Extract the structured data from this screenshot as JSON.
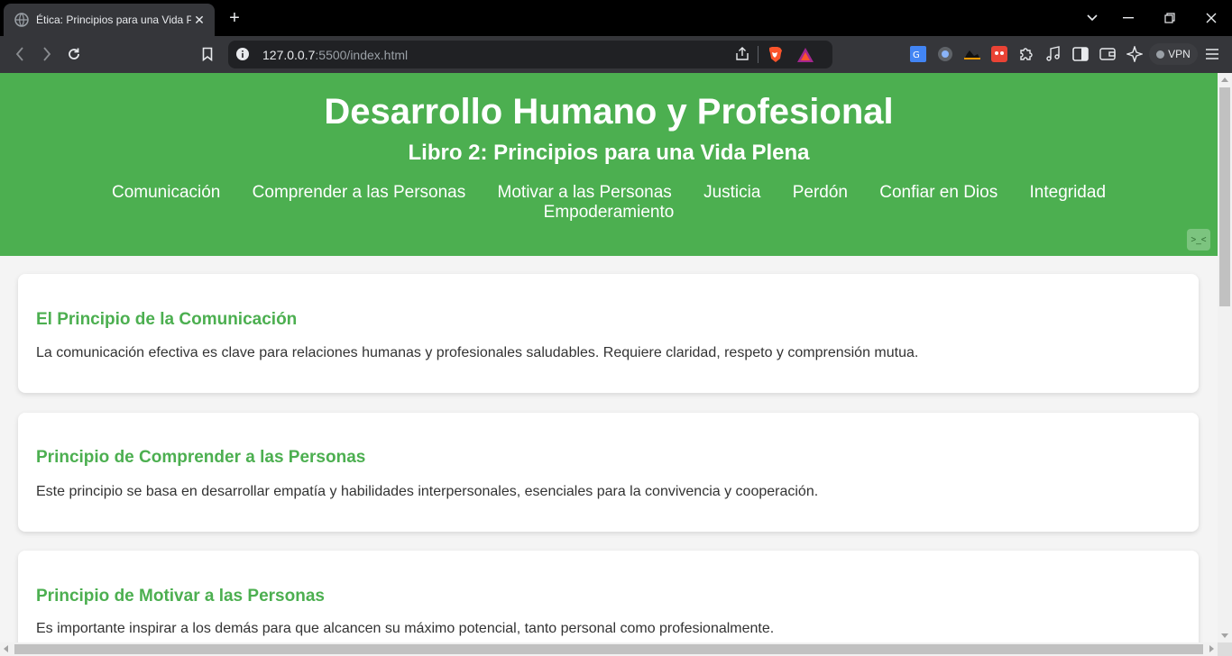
{
  "browser": {
    "tab_title": "Ética: Principios para una Vida P",
    "new_tab_label": "+",
    "url_host": "127.0.0.7",
    "url_rest": ":5500/index.html",
    "vpn_label": "VPN"
  },
  "header": {
    "title": "Desarrollo Humano y Profesional",
    "subtitle": "Libro 2: Principios para una Vida Plena",
    "nav": [
      "Comunicación",
      "Comprender a las Personas",
      "Motivar a las Personas",
      "Justicia",
      "Perdón",
      "Confiar en Dios",
      "Integridad",
      "Empoderamiento"
    ],
    "widget_label": ">_<"
  },
  "sections": [
    {
      "title": "El Principio de la Comunicación",
      "text": "La comunicación efectiva es clave para relaciones humanas y profesionales saludables. Requiere claridad, respeto y comprensión mutua."
    },
    {
      "title": "Principio de Comprender a las Personas",
      "text": "Este principio se basa en desarrollar empatía y habilidades interpersonales, esenciales para la convivencia y cooperación."
    },
    {
      "title": "Principio de Motivar a las Personas",
      "text": "Es importante inspirar a los demás para que alcancen su máximo potencial, tanto personal como profesionalmente."
    }
  ],
  "colors": {
    "accent": "#4caf50",
    "page_bg": "#f4f4f4",
    "card_bg": "#ffffff",
    "body_text": "#333333"
  }
}
